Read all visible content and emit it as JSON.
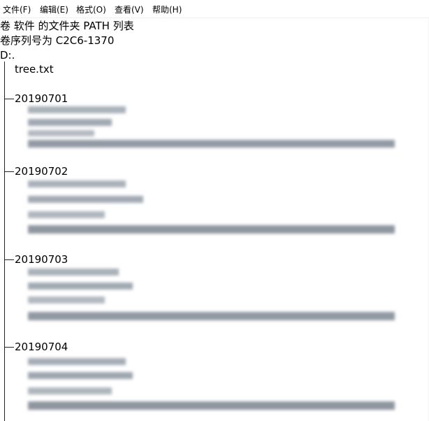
{
  "menu": [
    {
      "label": "文件(F)"
    },
    {
      "label": "编辑(E)"
    },
    {
      "label": "格式(O)"
    },
    {
      "label": "查看(V)"
    },
    {
      "label": "帮助(H)"
    }
  ],
  "header": {
    "line1": "卷 软件 的文件夹 PATH 列表",
    "line2": "卷序列号为 C2C6-1370",
    "line3": "D:."
  },
  "tree": {
    "root_file": "tree.txt",
    "folders": [
      {
        "name": "20190701"
      },
      {
        "name": "20190702"
      },
      {
        "name": "20190703"
      },
      {
        "name": "20190704"
      }
    ]
  }
}
